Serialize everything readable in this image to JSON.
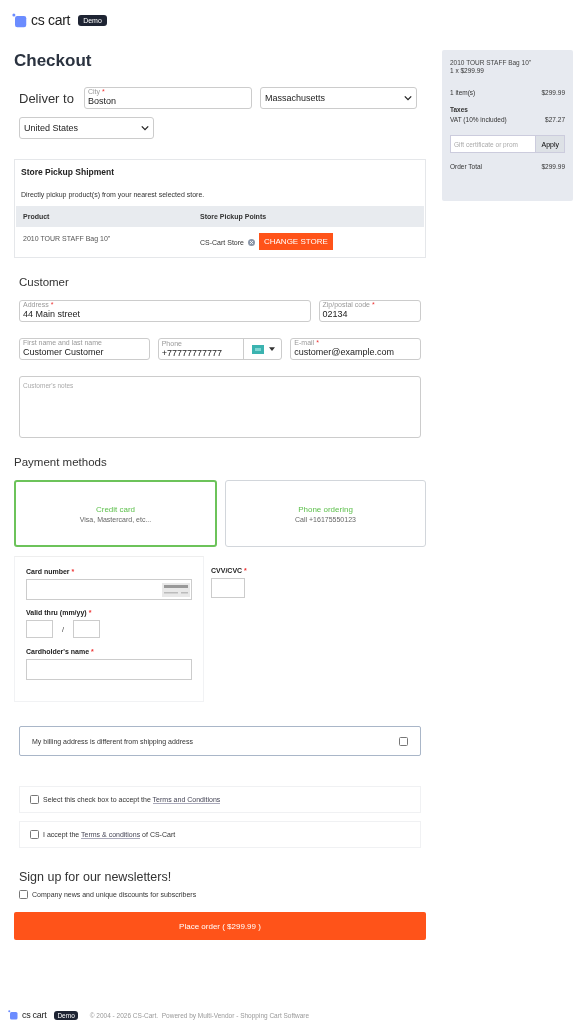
{
  "header": {
    "logo": "cs cart",
    "badge": "Demo"
  },
  "page_title": "Checkout",
  "deliver": {
    "label": "Deliver to",
    "city": {
      "label": "City",
      "mark": "*",
      "value": "Boston"
    },
    "state": "Massachusetts",
    "country": "United States"
  },
  "pickup": {
    "title": "Store Pickup Shipment",
    "description": "Directly pickup product(s) from your nearest selected store.",
    "columns": [
      "Product",
      "Store Pickup Points"
    ],
    "rows": [
      {
        "product": "2010 TOUR STAFF Bag 10\"",
        "store": "CS-Cart Store",
        "button": "CHANGE STORE"
      }
    ]
  },
  "customer": {
    "title": "Customer",
    "address": {
      "label": "Address",
      "mark": "*",
      "value": "44 Main street"
    },
    "zip": {
      "label": "Zip/postal code",
      "mark": "*",
      "value": "02134"
    },
    "name": {
      "label": "First name and last name",
      "value": "Customer Customer"
    },
    "phone": {
      "label": "Phone",
      "value": "+77777777777"
    },
    "email": {
      "label": "E-mail",
      "mark": "*",
      "value": "customer@example.com"
    },
    "notes_placeholder": "Customer's notes"
  },
  "payment": {
    "title": "Payment methods",
    "methods": [
      {
        "name": "Credit card",
        "description": "Visa, Mastercard, etc...",
        "selected": true
      },
      {
        "name": "Phone ordering",
        "description": "Call +16175550123",
        "selected": false
      }
    ],
    "card_number": {
      "label": "Card number",
      "mark": "*"
    },
    "valid_thru": {
      "label": "Valid thru (mm/yy)",
      "mark": "*",
      "separator": "/"
    },
    "cardholder": {
      "label": "Cardholder's name",
      "mark": "*"
    },
    "cvv": {
      "label": "CVV/CVC",
      "mark": "*"
    }
  },
  "billing": {
    "label": "My billing address is different from shipping address",
    "checked": false
  },
  "agreements": [
    {
      "before": "Select this check box to accept the ",
      "link": "Terms and Conditions",
      "checked": false
    },
    {
      "before": "I accept the ",
      "link": "Terms & conditions",
      "after": " of CS-Cart",
      "checked": false
    }
  ],
  "newsletter": {
    "title": "Sign up for our newsletters!",
    "label": "Company news and unique discounts for subscribers",
    "checked": false
  },
  "place_order": "Place order ( $299.99 )",
  "summary": {
    "product": "2010 TOUR STAFF Bag 10\"",
    "quantity": "1 x $299.99",
    "items_label": "1 item(s)",
    "items_total": "$299.99",
    "taxes_title": "Taxes",
    "tax_label": "VAT (10% included)",
    "tax_value": "$27.27",
    "promo_placeholder": "Gift certificate or prom",
    "apply": "Apply",
    "total_label": "Order Total",
    "total_value": "$299.99"
  },
  "footer": {
    "logo": "cs cart",
    "badge": "Demo",
    "copyright": "© 2004 - 2026 CS-Cart.  Powered by Multi-Vendor - Shopping Cart Software"
  }
}
